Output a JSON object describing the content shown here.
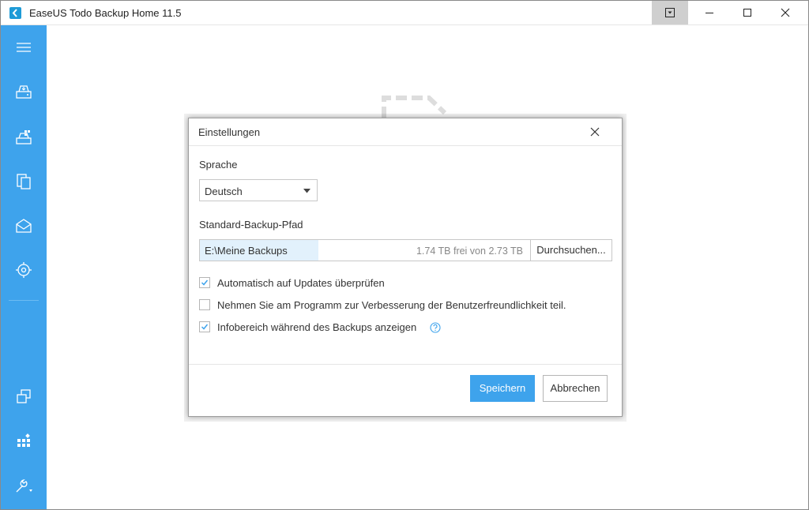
{
  "window": {
    "title": "EaseUS Todo Backup Home 11.5"
  },
  "sidebar": {
    "items": [
      {
        "icon": "menu-icon"
      },
      {
        "icon": "disk-backup-icon"
      },
      {
        "icon": "system-backup-icon"
      },
      {
        "icon": "file-backup-icon"
      },
      {
        "icon": "mail-backup-icon"
      },
      {
        "icon": "smart-backup-icon"
      },
      {
        "icon": "clone-icon"
      },
      {
        "icon": "apps-icon"
      },
      {
        "icon": "tools-icon"
      }
    ]
  },
  "dialog": {
    "title": "Einstellungen",
    "language_label": "Sprache",
    "language_value": "Deutsch",
    "path_label": "Standard-Backup-Pfad",
    "path_value": "E:\\Meine Backups",
    "path_free": "1.74 TB frei von 2.73 TB",
    "path_usage_fraction": 0.36,
    "browse_label": "Durchsuchen...",
    "options": [
      {
        "label": "Automatisch auf Updates überprüfen",
        "checked": true
      },
      {
        "label": "Nehmen Sie am Programm zur Verbesserung der Benutzerfreundlichkeit teil.",
        "checked": false
      },
      {
        "label": "Infobereich während des Backups anzeigen",
        "checked": true
      }
    ],
    "save_label": "Speichern",
    "cancel_label": "Abbrechen"
  },
  "colors": {
    "accent": "#3ea3ec",
    "path_fill": "#e2f1fc"
  }
}
